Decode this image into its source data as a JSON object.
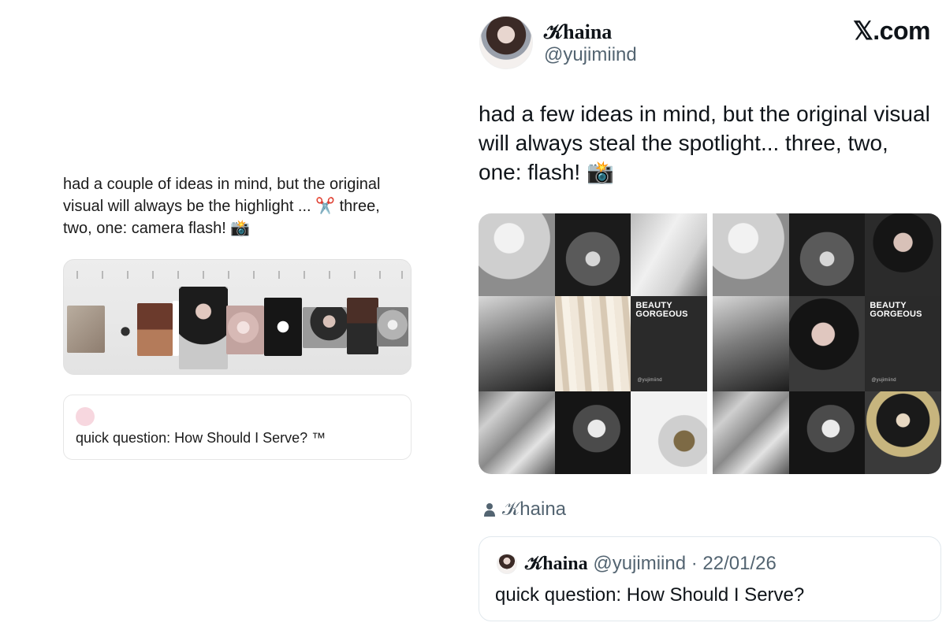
{
  "left_card": {
    "text": "had a couple of ideas in mind, but the original visual will always be the highlight ... ✂️ three, two, one: camera flash! 📸",
    "quote_text": "quick question: How Should I Serve? ™"
  },
  "right_tweet": {
    "display_name": "𝒦haina",
    "handle": "@yujimiind",
    "site_label": ".com",
    "text": "had a few ideas in mind, but the original visual will always steal the spotlight... three, two, one: flash! 📸",
    "tiles": {
      "beauty_title": "BEAUTY\nGORGEOUS",
      "beauty_handle": "@yujimiind"
    },
    "byline": "𝒦haina",
    "quote": {
      "name": "𝒦haina",
      "handle": "@yujimiind",
      "dot": "·",
      "date": "22/01/26",
      "text": "quick question: How Should I Serve?"
    }
  }
}
